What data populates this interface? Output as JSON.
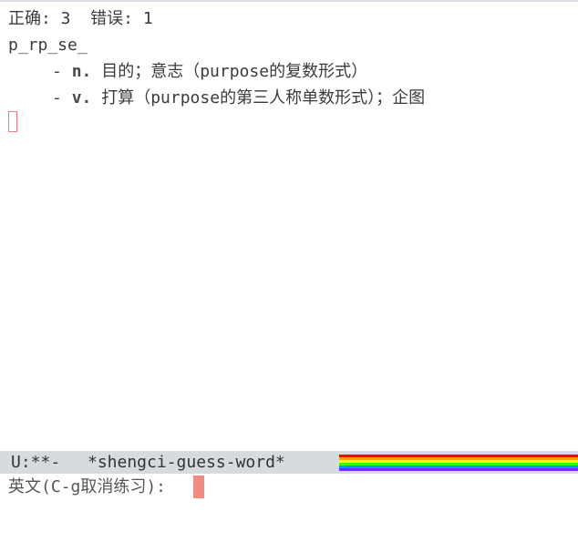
{
  "score_line": "正确: 3  错误: 1",
  "pattern": "p_rp_se_",
  "definitions": [
    {
      "dash": "- ",
      "pos": "n.",
      "text": " 目的；意志（purpose的复数形式）"
    },
    {
      "dash": "- ",
      "pos": "v.",
      "text": " 打算（purpose的第三人称单数形式）；企图"
    }
  ],
  "mode_line": {
    "status": "U:**-",
    "buffer_name": "*shengci-guess-word*",
    "colors": [
      "#ff0000",
      "#ff9900",
      "#ffff00",
      "#33ff00",
      "#0099ff",
      "#6633ff"
    ]
  },
  "minibuffer": {
    "prompt": "英文(C-g取消练习): "
  },
  "cursor_color": "#f28b82"
}
